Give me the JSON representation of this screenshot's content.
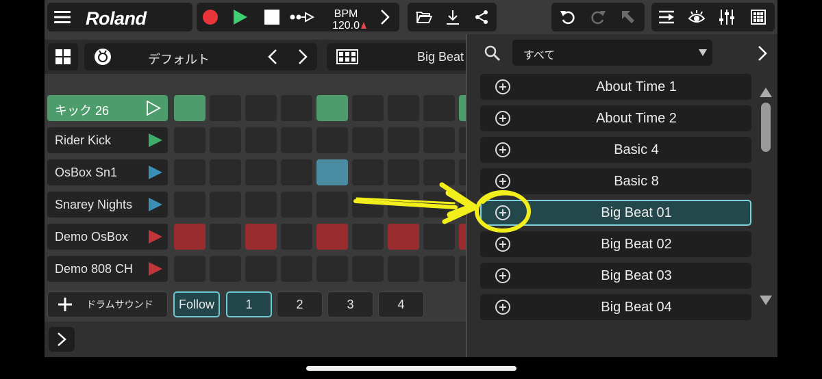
{
  "app": {
    "brand": "Roland"
  },
  "transport": {
    "bpm_label": "BPM",
    "bpm_value": "120.0"
  },
  "kit": {
    "name": "デフォルト"
  },
  "pattern": {
    "name": "Big Beat"
  },
  "tracks": [
    {
      "name": "キック 26",
      "color": "#3cae6a",
      "selected": true
    },
    {
      "name": "Rider Kick",
      "color": "#3cae6a",
      "selected": false
    },
    {
      "name": "OsBox Sn1",
      "color": "#3a8fb5",
      "selected": false
    },
    {
      "name": "Snarey Nights",
      "color": "#3a8fb5",
      "selected": false
    },
    {
      "name": "Demo OsBox",
      "color": "#c0353a",
      "selected": false
    },
    {
      "name": "Demo 808 CH",
      "color": "#c0353a",
      "selected": false
    }
  ],
  "footer": {
    "add_drum_label": "ドラムサウンド",
    "follow_label": "Follow",
    "pages": [
      "1",
      "2",
      "3",
      "4"
    ],
    "active_page": "1"
  },
  "browser": {
    "filter": "すべて",
    "items": [
      {
        "label": "About Time 1",
        "selected": false
      },
      {
        "label": "About Time 2",
        "selected": false
      },
      {
        "label": "Basic 4",
        "selected": false
      },
      {
        "label": "Basic 8",
        "selected": false
      },
      {
        "label": "Big Beat 01",
        "selected": true
      },
      {
        "label": "Big Beat 02",
        "selected": false
      },
      {
        "label": "Big Beat 03",
        "selected": false
      },
      {
        "label": "Big Beat 04",
        "selected": false
      }
    ]
  },
  "colors": {
    "accent": "#7ed0da",
    "step_green": "#4c9c6c",
    "step_blue": "#4a8da3",
    "step_red": "#9a2c30",
    "annotation_yellow": "#f2ee1c"
  }
}
